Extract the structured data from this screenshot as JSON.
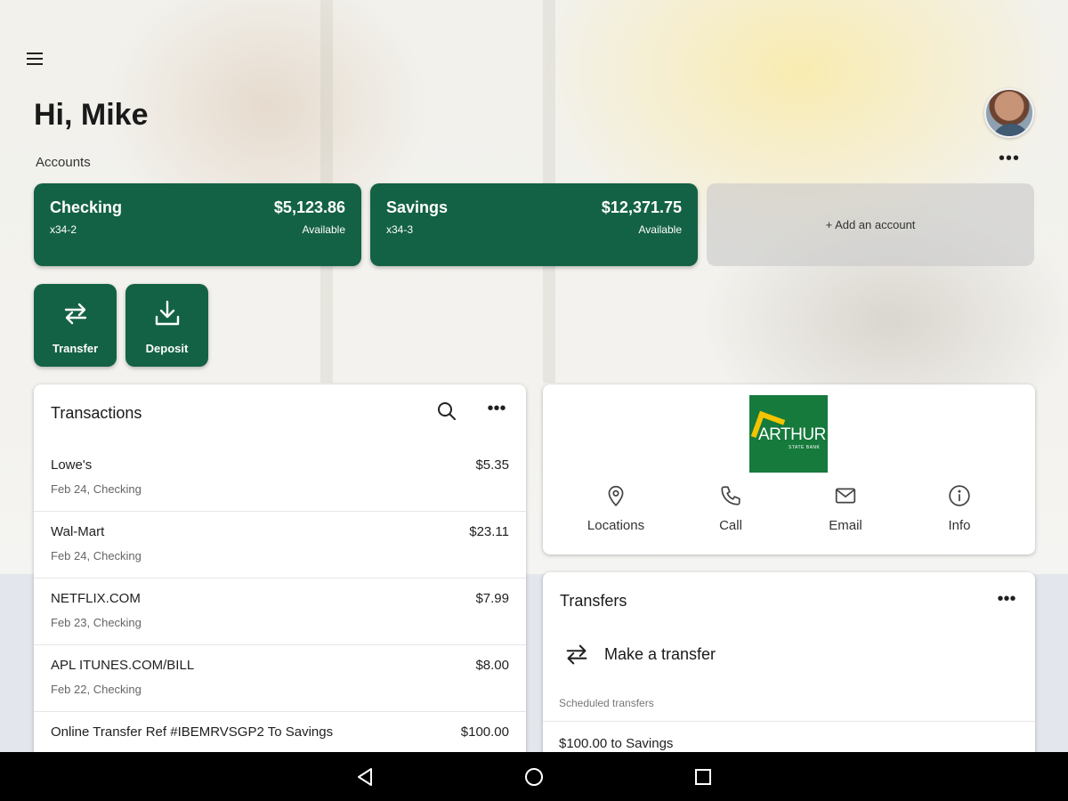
{
  "header": {
    "greeting": "Hi, Mike",
    "menu_icon": "hamburger-menu-icon",
    "avatar": "user-avatar"
  },
  "accounts": {
    "label": "Accounts",
    "more_label": "•••",
    "items": [
      {
        "name": "Checking",
        "number": "x34-2",
        "balance": "$5,123.86",
        "status": "Available"
      },
      {
        "name": "Savings",
        "number": "x34-3",
        "balance": "$12,371.75",
        "status": "Available"
      }
    ],
    "add_label": "+ Add an account"
  },
  "actions": [
    {
      "label": "Transfer",
      "icon": "transfer-arrows-icon"
    },
    {
      "label": "Deposit",
      "icon": "deposit-download-icon"
    }
  ],
  "transactions": {
    "title": "Transactions",
    "more_label": "•••",
    "rows": [
      {
        "description": "Lowe's",
        "meta": "Feb 24, Checking",
        "amount": "$5.35"
      },
      {
        "description": "Wal-Mart",
        "meta": "Feb 24, Checking",
        "amount": "$23.11"
      },
      {
        "description": "NETFLIX.COM",
        "meta": "Feb 23, Checking",
        "amount": "$7.99"
      },
      {
        "description": "APL ITUNES.COM/BILL",
        "meta": "Feb 22, Checking",
        "amount": "$8.00"
      },
      {
        "description": "Online Transfer Ref #IBEMRVSGP2 To Savings",
        "meta": "",
        "amount": "$100.00"
      }
    ]
  },
  "bank": {
    "logo_text": "ARTHUR",
    "logo_subtext": "STATE BANK",
    "contacts": [
      {
        "label": "Locations",
        "icon": "location-pin-icon"
      },
      {
        "label": "Call",
        "icon": "phone-icon"
      },
      {
        "label": "Email",
        "icon": "envelope-icon"
      },
      {
        "label": "Info",
        "icon": "info-icon"
      }
    ]
  },
  "transfers": {
    "title": "Transfers",
    "more_label": "•••",
    "make_transfer_label": "Make a transfer",
    "scheduled_label": "Scheduled transfers",
    "scheduled_items": [
      "$100.00 to Savings"
    ]
  },
  "colors": {
    "brand_green": "#146245",
    "logo_green": "#157a3c",
    "logo_yellow": "#f3c400"
  }
}
